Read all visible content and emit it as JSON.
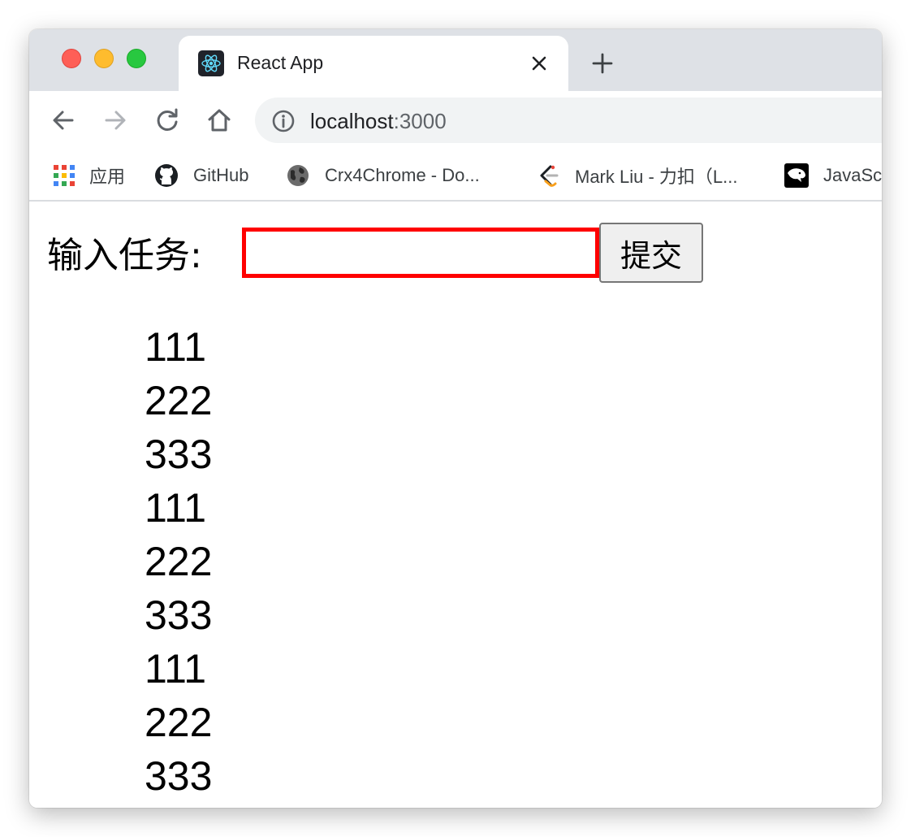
{
  "browser": {
    "tab": {
      "title": "React App",
      "favicon": "react-logo-icon"
    },
    "toolbar": {
      "url_host": "localhost",
      "url_port": ":3000"
    },
    "bookmarks": [
      {
        "label": "应用",
        "icon": "apps-grid-icon"
      },
      {
        "label": "GitHub",
        "icon": "github-icon"
      },
      {
        "label": "Crx4Chrome - Do...",
        "icon": "globe-icon"
      },
      {
        "label": "Mark Liu - 力扣（L...",
        "icon": "leetcode-icon"
      },
      {
        "label": "JavaSc",
        "icon": "panther-icon"
      }
    ]
  },
  "page": {
    "form": {
      "label": "输入任务:",
      "input_value": "",
      "submit_label": "提交"
    },
    "tasks": [
      "111",
      "222",
      "333",
      "111",
      "222",
      "333",
      "111",
      "222",
      "333"
    ]
  },
  "colors": {
    "input_border": "#ff0000",
    "tabstrip_bg": "#dee1e6"
  }
}
